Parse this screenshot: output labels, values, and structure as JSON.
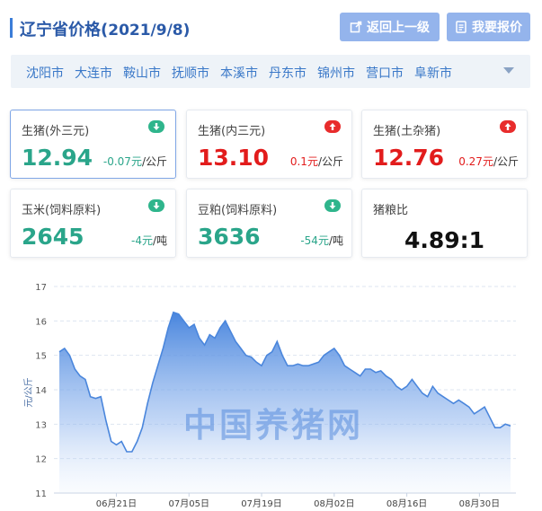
{
  "header": {
    "title": "辽宁省价格(",
    "date": "2021/9/8)",
    "back_button": "返回上一级",
    "quote_button": "我要报价"
  },
  "cities": [
    "沈阳市",
    "大连市",
    "鞍山市",
    "抚顺市",
    "本溪市",
    "丹东市",
    "锦州市",
    "营口市",
    "阜新市"
  ],
  "cards": [
    {
      "name": "生猪(外三元)",
      "value": "12.94",
      "change": "-0.07元",
      "unit": "/公斤",
      "trend": "down",
      "color": "#2aa58a"
    },
    {
      "name": "生猪(内三元)",
      "value": "13.10",
      "change": "0.1元",
      "unit": "/公斤",
      "trend": "up",
      "color": "#e21c1c"
    },
    {
      "name": "生猪(土杂猪)",
      "value": "12.76",
      "change": "0.27元",
      "unit": "/公斤",
      "trend": "up",
      "color": "#e21c1c"
    },
    {
      "name": "玉米(饲料原料)",
      "value": "2645",
      "change": "-4元",
      "unit": "/吨",
      "trend": "down",
      "color": "#2aa58a"
    },
    {
      "name": "豆粕(饲料原料)",
      "value": "3636",
      "change": "-54元",
      "unit": "/吨",
      "trend": "down",
      "color": "#2aa58a"
    },
    {
      "name": "猪粮比",
      "value": "4.89:1"
    }
  ],
  "watermark": "中国养猪网",
  "chart_data": {
    "type": "area",
    "ylabel": "元/公斤",
    "ylim": [
      11,
      17
    ],
    "yticks": [
      11,
      12,
      13,
      14,
      15,
      16,
      17
    ],
    "xticks": [
      "06月21日",
      "07月05日",
      "07月19日",
      "08月02日",
      "08月16日",
      "08月30日"
    ],
    "xtick_index": [
      11,
      25,
      39,
      53,
      67,
      81
    ],
    "series": [
      {
        "values": [
          15.1,
          15.2,
          15.0,
          14.6,
          14.4,
          14.3,
          13.8,
          13.75,
          13.8,
          13.1,
          12.5,
          12.4,
          12.5,
          12.2,
          12.2,
          12.5,
          12.9,
          13.6,
          14.2,
          14.7,
          15.2,
          15.8,
          16.25,
          16.2,
          16.0,
          15.8,
          15.9,
          15.5,
          15.3,
          15.6,
          15.5,
          15.8,
          16.0,
          15.7,
          15.4,
          15.2,
          15.0,
          14.95,
          14.8,
          14.7,
          15.0,
          15.1,
          15.4,
          15.0,
          14.7,
          14.7,
          14.75,
          14.7,
          14.7,
          14.75,
          14.8,
          15.0,
          15.1,
          15.2,
          15.0,
          14.7,
          14.6,
          14.5,
          14.4,
          14.6,
          14.6,
          14.5,
          14.55,
          14.4,
          14.3,
          14.1,
          14.0,
          14.1,
          14.3,
          14.1,
          13.9,
          13.8,
          14.1,
          13.9,
          13.8,
          13.7,
          13.6,
          13.7,
          13.6,
          13.5,
          13.3,
          13.4,
          13.5,
          13.2,
          12.9,
          12.9,
          13.0,
          12.95
        ]
      }
    ]
  }
}
